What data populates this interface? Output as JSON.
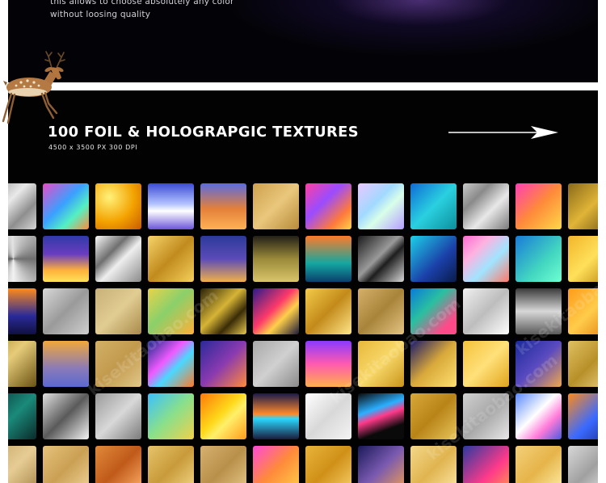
{
  "intro": {
    "line1": "this allows to choose absolutely any color",
    "line2": "without loosing quality"
  },
  "headline": "100 FOIL & HOLOGRAPGIC TEXTURES",
  "subline": "4500 x 3500 PX 300 DPI",
  "icons": {
    "arrow": "arrow-right-icon",
    "deer": "deer-icon"
  },
  "colors": {
    "background": "#020203",
    "text": "#ffffff"
  },
  "watermarks": [
    "kisekitaobao.com",
    "kisekitaobao.com",
    "kisekitaobao.com",
    "kisekitaobao.com"
  ],
  "textures": [
    [
      "linear-gradient(135deg,#9a9a9a,#e9e9e9 40%,#8e8e8e 70%,#d6d6d6)",
      "linear-gradient(135deg,#e84cc7,#39a1ff 45%,#55f0c3 70%,#ff8a3c)",
      "radial-gradient(circle at 30% 30%,#fff27a,#f3a200 55%,#c75a00)",
      "linear-gradient(180deg,#3b4bd6,#b3c3ff 45%,#ffffff 60%,#6c55d9)",
      "linear-gradient(180deg,#5b6be0,#e3803a 55%,#ffb155)",
      "linear-gradient(135deg,#cfa14e,#e9c77c 50%,#b78a3a)",
      "linear-gradient(135deg,#ff3fa0,#9a4cff 40%,#ff7a3a 75%,#ffd34a)",
      "linear-gradient(135deg,#e8c9ff,#a1d9ff 40%,#d8ffe8 60%,#b69cff)",
      "linear-gradient(135deg,#0f6bd6,#2ad0e0 50%,#0c8f9c)",
      "linear-gradient(135deg,#c9c9c9,#8a8a8a 30%,#e8e8e8 60%,#7a7a7a)",
      "linear-gradient(135deg,#ff3fb3,#ff8a3a 50%,#ffd84a)",
      "linear-gradient(135deg,#8a6a1a,#e0b437 50%,#6e5312)"
    ],
    [
      "conic-gradient(from 0deg,#dcdcdc,#6f6f6f,#f2f2f2,#5a5a5a,#e6e6e6)",
      "linear-gradient(180deg,#303aa8,#6a3dbf 40%,#ffb13a 75%,#ffe35a)",
      "linear-gradient(135deg,#fafafa,#6f6f6f 35%,#eeeeee 55%,#8a8a8a)",
      "linear-gradient(135deg,#f6d36a,#c18b1e 50%,#f4cf5c)",
      "linear-gradient(180deg,#2c3a9a,#5b4bb8 50%,#f0b04a)",
      "linear-gradient(180deg,#232018,#9a8a3a 50%,#d9c56a)",
      "linear-gradient(180deg,#ff7a2a,#13a7a0 60%,#0b3f6e)",
      "linear-gradient(135deg,#1a1a1a,#9a9a9a 45%,#1e1e1e 60%,#d8d8d8)",
      "linear-gradient(135deg,#1dd0e8,#1a3fa8 60%,#0a1c4a)",
      "linear-gradient(135deg,#ff6ad1,#ffb2e0 30%,#a1e4ff 60%,#ff7a6a)",
      "linear-gradient(135deg,#1a7ad8,#43d6c0 60%,#70ffd3)",
      "linear-gradient(135deg,#f2b52a,#ffe05a 50%,#b8820e)"
    ],
    [
      "linear-gradient(180deg,#ff8a1a,#2a2a9a 60%,#101040)",
      "linear-gradient(135deg,#d8d8d8,#9a9a9a 50%,#cfcfcf)",
      "linear-gradient(135deg,#c9b07a,#e1cc92 50%,#a88a4a)",
      "linear-gradient(135deg,#e8d44a,#8ad06a 45%,#ffb03a)",
      "linear-gradient(135deg,#2a2208,#d6b436 45%,#3a2c08 70%,#e8c84a)",
      "linear-gradient(135deg,#2a1a8a,#ff3a6a 45%,#ffd04a 65%,#1a1a3a)",
      "linear-gradient(135deg,#f3cc4a,#c38a1a 50%,#ffe68a)",
      "linear-gradient(135deg,#d6b06a,#a8843a 50%,#e4c484)",
      "linear-gradient(135deg,#0a7ad8,#2ac0a0 40%,#ff4a8a 80%)",
      "linear-gradient(135deg,#f0f0f0,#bdbdbd 50%,#ffffff)",
      "linear-gradient(180deg,#3a3a3a,#d8d8d8 50%,#5a5a5a)",
      "linear-gradient(135deg,#ff9a1a,#ffcc4a 50%,#e07a0a)"
    ],
    [
      "linear-gradient(135deg,#b8943a,#e6cc7a 40%,#6a5212)",
      "linear-gradient(180deg,#f0a83a,#8a7ab8 60%,#5a6ad0)",
      "linear-gradient(135deg,#d2b066,#c29a4e 50%,#e2c78a)",
      "linear-gradient(135deg,#1a2a8a,#f05aff 40%,#4ad8ff 60%,#ff7a2a)",
      "linear-gradient(135deg,#2a2a9a,#8a3ab0 50%,#ff8a3a)",
      "linear-gradient(135deg,#a8a8a8,#d0d0d0 50%,#8a8a8a)",
      "linear-gradient(180deg,#8a3aff,#ff5ab0 50%,#ffb04a)",
      "linear-gradient(135deg,#e8b83a,#f8d86a 50%,#c8941a)",
      "linear-gradient(135deg,#1a1a6a,#d8a83a 50%,#ffe070)",
      "linear-gradient(135deg,#f6c23a,#ffe07a 50%,#e0a41a)",
      "linear-gradient(135deg,#1a2a9a,#5a4ac0 50%,#f0a84a)",
      "linear-gradient(135deg,#e0c060,#b8902a 50%,#f0d488)"
    ],
    [
      "linear-gradient(135deg,#0a3a3a,#1a8a7a 50%,#0a2a2a)",
      "linear-gradient(135deg,#e0e0e0,#5a5a5a 50%,#f4f4f4)",
      "linear-gradient(135deg,#9a9a9a,#d8d8d8 50%,#7a7a7a)",
      "linear-gradient(135deg,#3ac0ff,#8ae08a 50%,#f0d04a)",
      "linear-gradient(135deg,#ff7a0a,#ffd81a 45%,#fff06a 60%,#ff9a1a)",
      "linear-gradient(180deg,#1a1a4a,#ff8a2a 45%,#2ad8ff 55%,#1a1a3a)",
      "linear-gradient(135deg,#ffffff,#d8d8d8 50%,#f4f4f4)",
      "linear-gradient(160deg,#0a0a0a,#2ab0ff 35%,#ff3a8a 50%,#0a0a0a 75%)",
      "linear-gradient(135deg,#d8a83a,#b88418 50%,#e8c45a)",
      "linear-gradient(135deg,#d0d0d0,#a8a8a8 50%,#e8e8e8)",
      "linear-gradient(135deg,#5a8aff,#ffffff 45%,#ff7ad8 70%,#4a5ae0)",
      "linear-gradient(135deg,#ff8a1a,#3a6aff 55%,#1a2a8a)"
    ],
    [
      "linear-gradient(135deg,#c8a86a,#e6cc94 50%,#a8884a)",
      "linear-gradient(135deg,#e6c27a,#caa054 50%,#f0d49a)",
      "linear-gradient(135deg,#e08a3a,#c05a1a 50%,#ffb06a)",
      "linear-gradient(135deg,#e6c46a,#c89a3a 50%,#f4d888)",
      "linear-gradient(135deg,#d8b070,#b8904a 50%,#e8c88a)",
      "linear-gradient(135deg,#ff4ad8,#ff8a3a 50%,#ffd04a)",
      "linear-gradient(135deg,#e8b43a,#d09018 50%,#f8d06a)",
      "linear-gradient(135deg,#1a1a5a,#7a5ab0 50%,#f0a050)",
      "linear-gradient(135deg,#f4d88a,#e0b450 50%,#ffe8a8)",
      "linear-gradient(135deg,#2a3aa0,#ff3a8a 60%,#ff9a4a)",
      "linear-gradient(135deg,#f4d07a,#e6b44a 50%,#fff0a8)",
      "linear-gradient(135deg,#d8d8d8,#a0a0a0 50%,#f0f0f0)"
    ]
  ]
}
